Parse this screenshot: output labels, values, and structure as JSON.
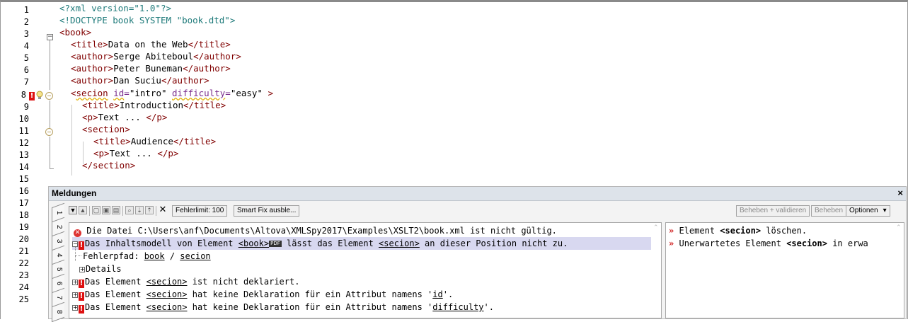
{
  "editor": {
    "line_numbers": [
      "1",
      "2",
      "3",
      "4",
      "5",
      "6",
      "7",
      "8",
      "9",
      "10",
      "11",
      "12",
      "13",
      "14",
      "15",
      "16",
      "17",
      "18",
      "19",
      "20",
      "21",
      "22",
      "23",
      "24",
      "25"
    ],
    "lines": {
      "l1": "<?xml version=\"1.0\"?>",
      "l2": "<!DOCTYPE book SYSTEM \"book.dtd\">",
      "l3_open": "<",
      "l3_tag": "book",
      "l3_close": ">",
      "l4_open": "<title>",
      "l4_text": "Data on the Web",
      "l4_close": "</title>",
      "l5_open": "<author>",
      "l5_text": "Serge Abiteboul",
      "l5_close": "</author>",
      "l6_open": "<author>",
      "l6_text": "Peter Buneman",
      "l6_close": "</author>",
      "l7_open": "<author>",
      "l7_text": "Dan Suciu",
      "l7_close": "</author>",
      "l8_lt": "<",
      "l8_tag": "secion",
      "l8_attr1": "id",
      "l8_eq1": "=",
      "l8_val1": "\"intro\"",
      "l8_attr2": "difficulty",
      "l8_eq2": "=",
      "l8_val2": "\"easy\"",
      "l8_gt": " >",
      "l9_open": "<title>",
      "l9_text": "Introduction",
      "l9_close": "</title>",
      "l10_open": "<p>",
      "l10_text": "Text ... ",
      "l10_close": "</p>",
      "l11": "<section>",
      "l12_open": "<title>",
      "l12_text": "Audience",
      "l12_close": "</title>",
      "l13_open": "<p>",
      "l13_text": "Text ... ",
      "l13_close": "</p>",
      "l14": "</section>"
    }
  },
  "messages_panel": {
    "title": "Meldungen",
    "close_glyph": "×",
    "tabs": [
      "1",
      "2",
      "3",
      "4",
      "5",
      "6",
      "7",
      "8"
    ],
    "toolbar": {
      "error_limit": "Fehlerlimit: 100",
      "smart_fix": "Smart Fix ausble...",
      "fix_validate": "Beheben + validieren",
      "fix": "Beheben",
      "options": "Optionen"
    },
    "messages": {
      "m1": "Die Datei C:\\Users\\anf\\Documents\\Altova\\XMLSpy2017\\Examples\\XSLT2\\book.xml ist nicht gültig.",
      "m2_a": "Das Inhaltsmodell von Element ",
      "m2_el": "<book>",
      "m2_badge": "PDF",
      "m2_b": " lässt das Element ",
      "m2_el2": "<secion>",
      "m2_c": " an dieser Position nicht zu.",
      "m3_a": "Fehlerpfad: ",
      "m3_book": "book",
      "m3_sep": " / ",
      "m3_secion": "secion",
      "m4": "Details",
      "m5_a": "Das Element ",
      "m5_el": "<secion>",
      "m5_b": " ist nicht deklariert.",
      "m6_a": "Das Element ",
      "m6_el": "<secion>",
      "m6_b": " hat keine Deklaration für ein Attribut namens '",
      "m6_attr": "id",
      "m6_c": "'.",
      "m7_a": "Das Element ",
      "m7_el": "<secion>",
      "m7_b": " hat keine Deklaration für ein Attribut namens '",
      "m7_attr": "difficulty",
      "m7_c": "'."
    },
    "fixes": {
      "f1_a": "Element ",
      "f1_el": "<secion>",
      "f1_b": " löschen.",
      "f2_a": "Unerwartetes Element ",
      "f2_el": "<secion>",
      "f2_b": " in erwa"
    }
  }
}
